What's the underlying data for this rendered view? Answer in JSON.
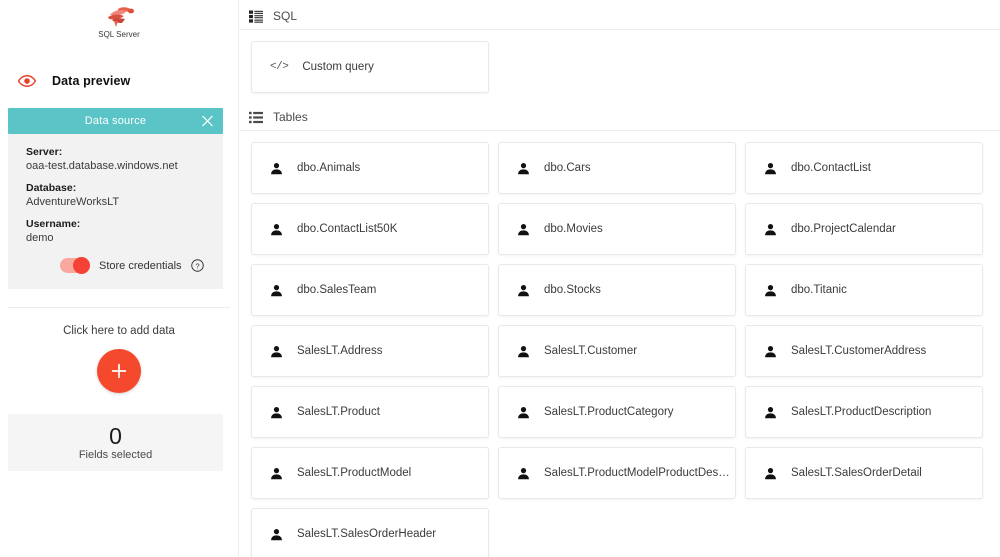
{
  "sidebar": {
    "logo_alt": "SQL Server",
    "logo_text": "SQL Server",
    "data_preview_label": "Data preview",
    "data_source": {
      "title": "Data source",
      "close_label": "×",
      "fields": [
        {
          "label": "Server:",
          "value": "oaa-test.database.windows.net"
        },
        {
          "label": "Database:",
          "value": "AdventureWorksLT"
        },
        {
          "label": "Username:",
          "value": "demo"
        }
      ],
      "toggle": {
        "label": "Store credentials",
        "state": "on",
        "color": "#f44336"
      },
      "help_label": "?"
    },
    "add_data": {
      "text": "Click here to add data",
      "button_label": "+",
      "button_color": "#f4492d"
    },
    "fields_selected": {
      "count": "0",
      "label": "Fields selected"
    }
  },
  "main": {
    "sql_section": {
      "title": "SQL",
      "items": [
        {
          "label": "Custom query",
          "icon": "code-icon"
        }
      ]
    },
    "tables_section": {
      "title": "Tables",
      "items": [
        {
          "label": "dbo.Animals"
        },
        {
          "label": "dbo.Cars"
        },
        {
          "label": "dbo.ContactList"
        },
        {
          "label": "dbo.ContactList50K"
        },
        {
          "label": "dbo.Movies"
        },
        {
          "label": "dbo.ProjectCalendar"
        },
        {
          "label": "dbo.SalesTeam"
        },
        {
          "label": "dbo.Stocks"
        },
        {
          "label": "dbo.Titanic"
        },
        {
          "label": "SalesLT.Address"
        },
        {
          "label": "SalesLT.Customer"
        },
        {
          "label": "SalesLT.CustomerAddress"
        },
        {
          "label": "SalesLT.Product"
        },
        {
          "label": "SalesLT.ProductCategory"
        },
        {
          "label": "SalesLT.ProductDescription"
        },
        {
          "label": "SalesLT.ProductModel"
        },
        {
          "label": "SalesLT.ProductModelProductDescript..."
        },
        {
          "label": "SalesLT.SalesOrderDetail"
        },
        {
          "label": "SalesLT.SalesOrderHeader"
        }
      ]
    }
  },
  "colors": {
    "teal_header": "#5ac4c6",
    "accent_red": "#f4492d",
    "toggle_on": "#f44336",
    "panel_gray": "#f2f2f2"
  }
}
